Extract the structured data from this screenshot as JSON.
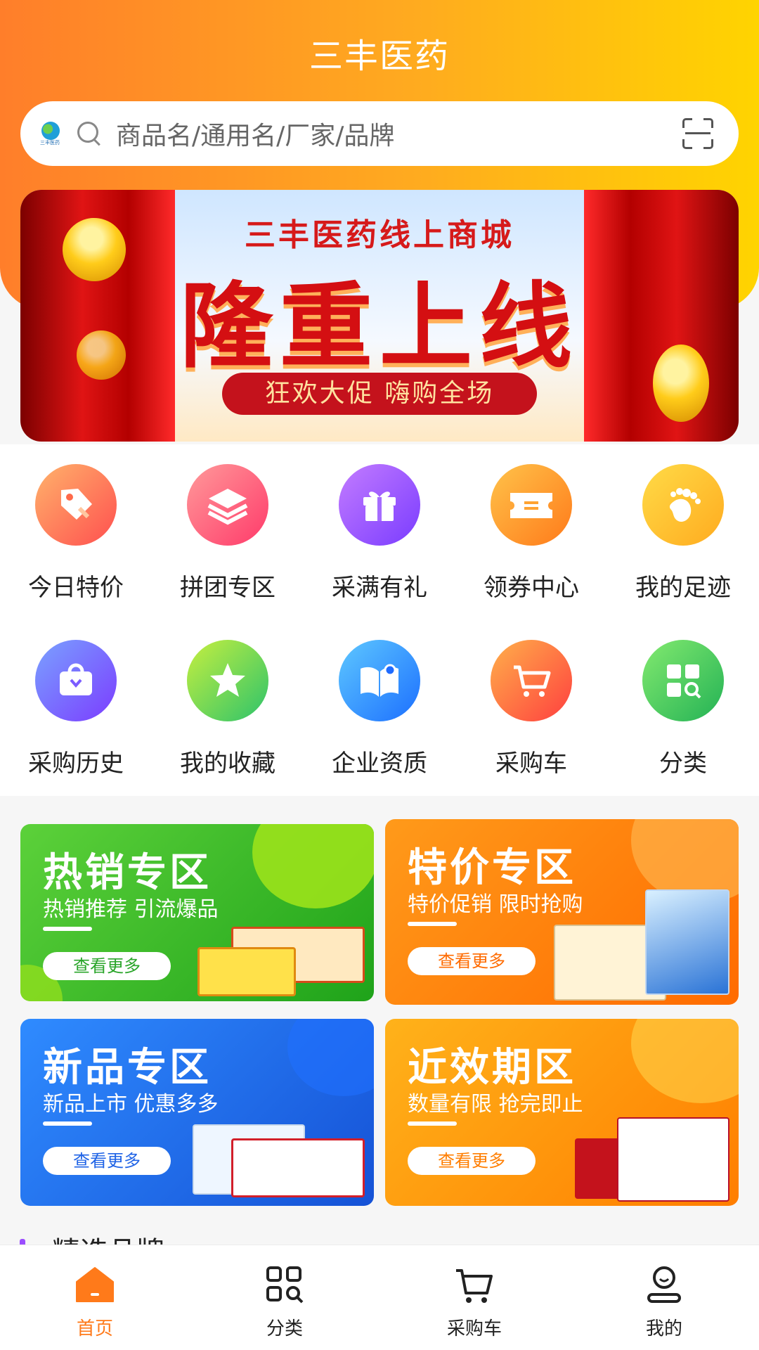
{
  "app": {
    "title": "三丰医药"
  },
  "search": {
    "placeholder": "商品名/通用名/厂家/品牌",
    "logo_text": "三丰医药"
  },
  "banner": {
    "subtitle": "三丰医药线上商城",
    "headline": "隆重上线",
    "tagline": "狂欢大促 嗨购全场"
  },
  "quick_menu": [
    {
      "label": "今日特价",
      "icon": "price-tag-icon"
    },
    {
      "label": "拼团专区",
      "icon": "layers-icon"
    },
    {
      "label": "采满有礼",
      "icon": "gift-icon"
    },
    {
      "label": "领券中心",
      "icon": "coupon-icon"
    },
    {
      "label": "我的足迹",
      "icon": "footprint-icon"
    },
    {
      "label": "采购历史",
      "icon": "shopping-bag-icon"
    },
    {
      "label": "我的收藏",
      "icon": "star-icon"
    },
    {
      "label": "企业资质",
      "icon": "certificate-book-icon"
    },
    {
      "label": "采购车",
      "icon": "cart-icon"
    },
    {
      "label": "分类",
      "icon": "category-grid-icon"
    }
  ],
  "promos": [
    {
      "title": "热销专区",
      "subtitle": "热销推荐 引流爆品",
      "more": "查看更多",
      "color": "#2fb426"
    },
    {
      "title": "特价专区",
      "subtitle": "特价促销 限时抢购",
      "more": "查看更多",
      "color": "#ff7a00"
    },
    {
      "title": "新品专区",
      "subtitle": "新品上市 优惠多多",
      "more": "查看更多",
      "color": "#1f63e6"
    },
    {
      "title": "近效期区",
      "subtitle": "数量有限 抢完即止",
      "more": "查看更多",
      "color": "#ff9200"
    }
  ],
  "section": {
    "title": "精选品牌"
  },
  "tabbar": [
    {
      "label": "首页",
      "icon": "home-icon",
      "active": true
    },
    {
      "label": "分类",
      "icon": "category-scan-icon",
      "active": false
    },
    {
      "label": "采购车",
      "icon": "cart-icon",
      "active": false
    },
    {
      "label": "我的",
      "icon": "profile-icon",
      "active": false
    }
  ],
  "colors": {
    "accent": "#ff7a1a",
    "header_start": "#ff7e2a",
    "header_end": "#ffd400"
  }
}
